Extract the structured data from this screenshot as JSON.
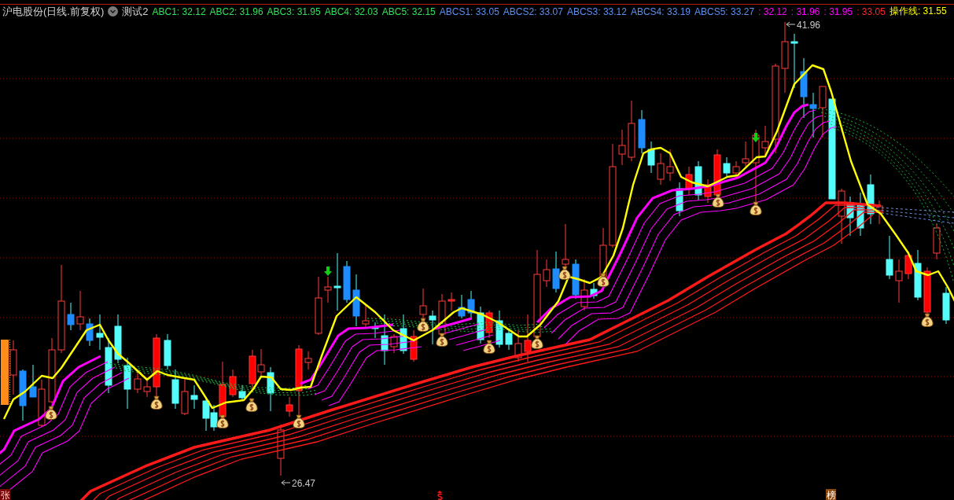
{
  "header": {
    "title": "沪电股份(日线.前复权)",
    "indicator": "测试2",
    "legend": [
      {
        "text": "ABC1: 32.12",
        "color": "#33e05a"
      },
      {
        "text": "ABC2: 31.96",
        "color": "#33e05a"
      },
      {
        "text": "ABC3: 31.95",
        "color": "#33e05a"
      },
      {
        "text": "ABC4: 32.03",
        "color": "#33e05a"
      },
      {
        "text": "ABC5: 32.15",
        "color": "#33e05a"
      },
      {
        "text": "ABCS1: 33.05",
        "color": "#5b8ff0"
      },
      {
        "text": "ABCS2: 33.07",
        "color": "#5b8ff0"
      },
      {
        "text": "ABCS3: 33.12",
        "color": "#5b8ff0"
      },
      {
        "text": "ABCS4: 33.19",
        "color": "#5b8ff0"
      },
      {
        "text": "ABCS5: 33.27",
        "color": "#5b8ff0"
      },
      {
        "text": ": 32.12",
        "color": "#ff00ff"
      },
      {
        "text": ": 31.96",
        "color": "#ff00ff"
      },
      {
        "text": ": 31.95",
        "color": "#ff00ff"
      },
      {
        "text": ": 33.05",
        "color": "#ff2828"
      },
      {
        "text": "操作线: 31.55",
        "color": "#ffff00"
      }
    ]
  },
  "chart": {
    "high_label": "41.96",
    "low_label": "26.47",
    "markers": [
      {
        "kind": "zhang",
        "text": "张"
      },
      {
        "kind": "bang",
        "text": "榜"
      }
    ]
  }
}
